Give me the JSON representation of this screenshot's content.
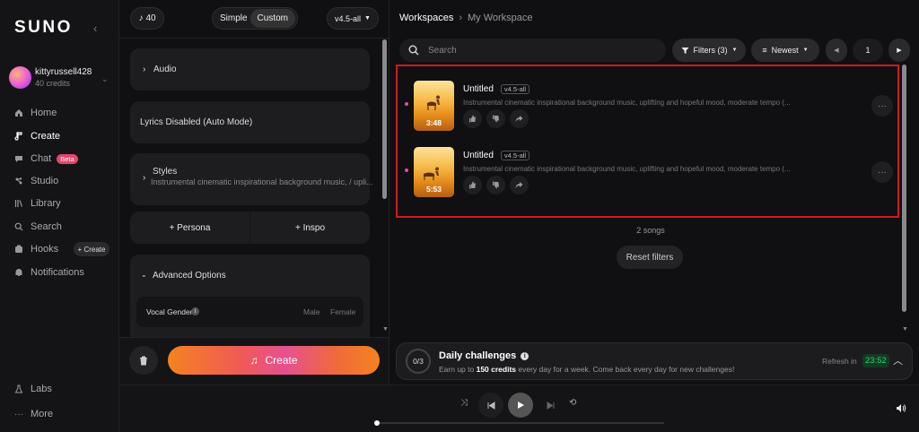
{
  "sidebar": {
    "logo": "SUNO",
    "user": {
      "name": "kittyrussell428",
      "credits": "40 credits"
    },
    "nav": [
      {
        "label": "Home",
        "icon": "home-icon"
      },
      {
        "label": "Create",
        "icon": "create-icon",
        "active": true
      },
      {
        "label": "Chat",
        "icon": "chat-icon",
        "badge": "Beta"
      },
      {
        "label": "Studio",
        "icon": "studio-icon"
      },
      {
        "label": "Library",
        "icon": "library-icon"
      },
      {
        "label": "Search",
        "icon": "search-icon"
      },
      {
        "label": "Hooks",
        "icon": "hooks-icon",
        "action": "+ Create"
      },
      {
        "label": "Notifications",
        "icon": "bell-icon"
      }
    ],
    "bottom": [
      {
        "label": "Labs",
        "icon": "flask-icon"
      },
      {
        "label": "More",
        "icon": "more-icon"
      }
    ]
  },
  "create": {
    "credits_pill": "40",
    "mode_tabs": [
      "Simple",
      "Custom"
    ],
    "active_mode": "Custom",
    "model": "v4.5-all",
    "audio_label": "Audio",
    "lyrics_label": "Lyrics Disabled (Auto Mode)",
    "styles_label": "Styles",
    "styles_value": "Instrumental cinematic inspirational background music, / upli...",
    "persona_label": "+ Persona",
    "inspo_label": "+ Inspo",
    "advanced_label": "Advanced Options",
    "vocal_gender_label": "Vocal Gender",
    "vocal_options": [
      "Male",
      "Female"
    ],
    "create_button": "Create"
  },
  "workspace": {
    "breadcrumb": [
      "Workspaces",
      "My Workspace"
    ],
    "search_placeholder": "Search",
    "filters_label": "Filters (3)",
    "sort_label": "Newest",
    "page": "1",
    "songs": [
      {
        "title": "Untitled",
        "version": "v4.5-all",
        "duration": "3:48",
        "description": "Instrumental cinematic inspirational background music, uplifting and hopeful mood, moderate tempo (..."
      },
      {
        "title": "Untitled",
        "version": "v4.5-all",
        "duration": "5:53",
        "description": "Instrumental cinematic inspirational background music, uplifting and hopeful mood, moderate tempo (..."
      }
    ],
    "song_count": "2 songs",
    "reset_label": "Reset filters"
  },
  "daily": {
    "progress": "0/3",
    "title": "Daily challenges",
    "desc_pre": "Earn up to ",
    "desc_bold": "150 credits",
    "desc_post": " every day for a week. Come back every day for new challenges!",
    "refresh_label": "Refresh in",
    "timer": "23:52"
  },
  "player": {
    "progress_fraction": 0.0
  },
  "colors": {
    "highlight_box": "#d11a1f",
    "accent_green": "#2bd46b",
    "beta_badge": "#e8456c"
  }
}
